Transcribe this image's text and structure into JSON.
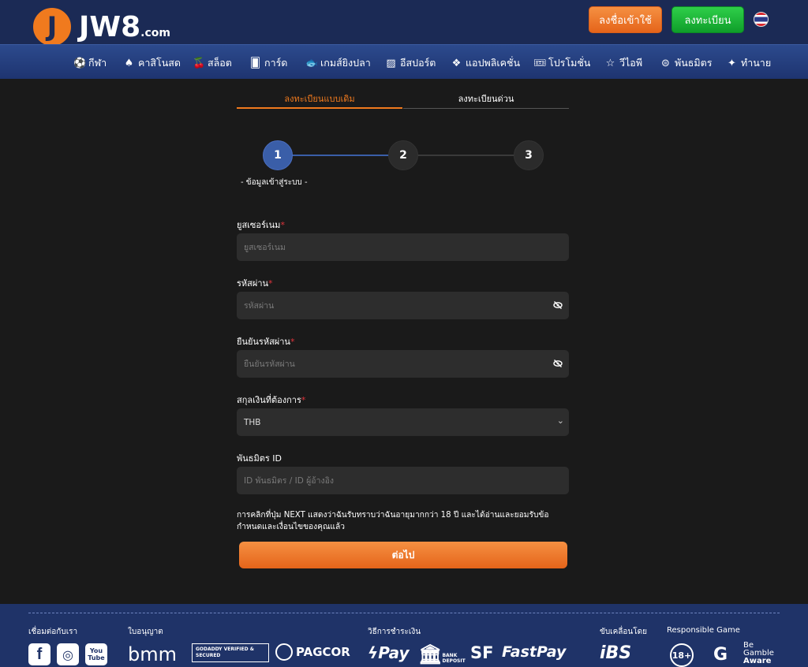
{
  "header": {
    "logo_letter": "J",
    "logo_text": "JW8",
    "logo_suffix": ".com",
    "login_label": "ลงชื่อเข้าใช้",
    "register_label": "ลงทะเบียน"
  },
  "nav": {
    "items": [
      {
        "label": "กีฬา",
        "icon": "soccer-ball-icon"
      },
      {
        "label": "คาสิโนสด",
        "icon": "spade-icon"
      },
      {
        "label": "สล็อต",
        "icon": "cherry-icon"
      },
      {
        "label": "การ์ด",
        "icon": "cards-icon"
      },
      {
        "label": "เกมส์ยิงปลา",
        "icon": "fish-icon"
      },
      {
        "label": "อีสปอร์ต",
        "icon": "esports-icon"
      },
      {
        "label": "แอปพลิเคชั่น",
        "icon": "app-icon"
      },
      {
        "label": "โปรโมชั่น",
        "icon": "ticket-icon"
      },
      {
        "label": "วีไอพี",
        "icon": "star-icon"
      },
      {
        "label": "พันธมิตร",
        "icon": "partner-icon"
      },
      {
        "label": "ทำนาย",
        "icon": "wand-icon"
      }
    ]
  },
  "tabs": {
    "standard": "ลงทะเบียนแบบเดิม",
    "quick": "ลงทะเบียนด่วน"
  },
  "steps": {
    "s1": "1",
    "s2": "2",
    "s3": "3",
    "caption": "- ข้อมูลเข้าสู่ระบบ -"
  },
  "form": {
    "username_label": "ยูสเซอร์เนม",
    "username_placeholder": "ยูสเซอร์เนม",
    "password_label": "รหัสผ่าน",
    "password_placeholder": "รหัสผ่าน",
    "confirm_label": "ยืนยันรหัสผ่าน",
    "confirm_placeholder": "ยืนยันรหัสผ่าน",
    "currency_label": "สกุลเงินที่ต้องการ",
    "currency_value": "THB",
    "partner_label": "พันธมิตร ID",
    "partner_placeholder": "ID พันธมิตร / ID ผู้อ้างอิง",
    "required_mark": "*",
    "terms_text": "การคลิกที่ปุ่ม NEXT แสดงว่าฉันรับทราบว่าฉันอายุมากกว่า 18 ปี และได้อ่านและยอมรับข้อกำหนดและเงื่อนไขของคุณแล้ว",
    "next_label": "ต่อไป"
  },
  "footer": {
    "connect": "เชื่อมต่อกับเรา",
    "license": "ใบอนุญาต",
    "payment": "วิธีการชำระเงิน",
    "powered": "ขับเคลื่อนโดย",
    "responsible": "Responsible Game",
    "social": [
      "f",
      "◎",
      "You Tube"
    ],
    "license_logos": [
      "bmm",
      "GODADDY VERIFIED & SECURED",
      "PAGCOR"
    ],
    "payment_logos": [
      "Pay",
      "BANK DEPOSIT",
      "SF",
      "FastPay"
    ],
    "powered_logo": "iBS",
    "age": "18+",
    "gamcare": "G",
    "be_aware": [
      "Be",
      "Gamble",
      "Aware"
    ]
  }
}
